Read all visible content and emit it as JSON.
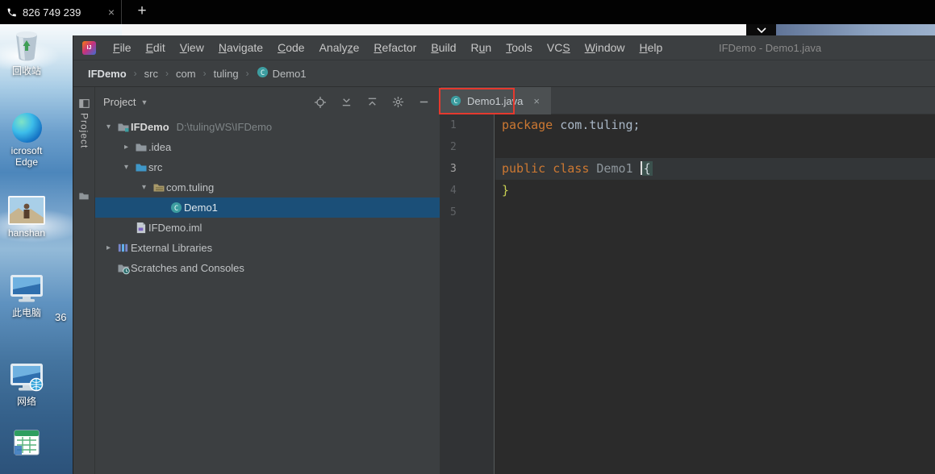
{
  "colors": {
    "annotation_red": "#e5392e",
    "tree_selection": "#1b4f78",
    "keyword_orange": "#cc7832",
    "editor_background": "#2b2b2b",
    "panel_background": "#3c3f41"
  },
  "browser": {
    "tab_title": "826 749 239",
    "tab_close": "×",
    "new_tab_button": "+"
  },
  "desktop": {
    "icons": [
      {
        "id": "recycle-bin",
        "label": "回收站"
      },
      {
        "id": "edge",
        "label": "icrosoft Edge"
      },
      {
        "id": "photo",
        "label": "hanshan"
      },
      {
        "id": "this-pc",
        "label": "此电脑"
      },
      {
        "id": "network",
        "label": "网络"
      },
      {
        "id": "spreadsheet",
        "label": ""
      }
    ],
    "partial_label": "36"
  },
  "ide": {
    "window_title": "IFDemo - Demo1.java",
    "breadcrumb_separator": "›",
    "breadcrumbs": [
      "IFDemo",
      "src",
      "com",
      "tuling",
      "Demo1"
    ],
    "tool_window_tab": "Project",
    "menu_items": [
      {
        "pre": "",
        "key": "F",
        "post": "ile"
      },
      {
        "pre": "",
        "key": "E",
        "post": "dit"
      },
      {
        "pre": "",
        "key": "V",
        "post": "iew"
      },
      {
        "pre": "",
        "key": "N",
        "post": "avigate"
      },
      {
        "pre": "",
        "key": "C",
        "post": "ode"
      },
      {
        "pre": "Analy",
        "key": "z",
        "post": "e"
      },
      {
        "pre": "",
        "key": "R",
        "post": "efactor"
      },
      {
        "pre": "",
        "key": "B",
        "post": "uild"
      },
      {
        "pre": "R",
        "key": "u",
        "post": "n"
      },
      {
        "pre": "",
        "key": "T",
        "post": "ools"
      },
      {
        "pre": "VC",
        "key": "S",
        "post": ""
      },
      {
        "pre": "",
        "key": "W",
        "post": "indow"
      },
      {
        "pre": "",
        "key": "H",
        "post": "elp"
      }
    ],
    "project_panel": {
      "title": "Project",
      "header_icons": [
        "locate-icon",
        "expand-icon",
        "collapse-all-icon",
        "settings-gear-icon",
        "hide-panel-icon"
      ],
      "tree": [
        {
          "indent": 0,
          "chevron": "expanded",
          "icon": "project-folder",
          "label": "IFDemo",
          "detail": "D:\\tulingWS\\IFDemo",
          "bold": true,
          "selected": false
        },
        {
          "indent": 1,
          "chevron": "collapsed",
          "icon": "folder",
          "label": ".idea",
          "selected": false
        },
        {
          "indent": 1,
          "chevron": "expanded",
          "icon": "source-folder",
          "label": "src",
          "selected": false
        },
        {
          "indent": 2,
          "chevron": "expanded",
          "icon": "package-folder",
          "label": "com.tuling",
          "selected": false
        },
        {
          "indent": 3,
          "chevron": "none",
          "icon": "java-class",
          "label": "Demo1",
          "selected": true
        },
        {
          "indent": 1,
          "chevron": "none",
          "icon": "module-file",
          "label": "IFDemo.iml",
          "selected": false
        },
        {
          "indent": 0,
          "chevron": "collapsed",
          "icon": "libraries",
          "label": "External Libraries",
          "selected": false
        },
        {
          "indent": 0,
          "chevron": "none",
          "icon": "scratches",
          "label": "Scratches and Consoles",
          "selected": false
        }
      ]
    },
    "editor": {
      "tab": {
        "title": "Demo1.java",
        "close": "×"
      },
      "line_numbers": [
        "1",
        "2",
        "3",
        "4",
        "5"
      ],
      "active_line": 3,
      "code_lines": [
        {
          "tokens": [
            {
              "text": "package ",
              "style": "keyword"
            },
            {
              "text": "com.tuling;",
              "style": "plain"
            }
          ]
        },
        {
          "tokens": []
        },
        {
          "tokens": [
            {
              "text": "public class ",
              "style": "keyword"
            },
            {
              "text": "Demo1 ",
              "style": "class-name"
            },
            {
              "text": "",
              "style": "caret"
            },
            {
              "text": "{",
              "style": "brace-open"
            }
          ]
        },
        {
          "tokens": [
            {
              "text": "}",
              "style": "brace-close"
            }
          ]
        },
        {
          "tokens": []
        }
      ]
    }
  }
}
